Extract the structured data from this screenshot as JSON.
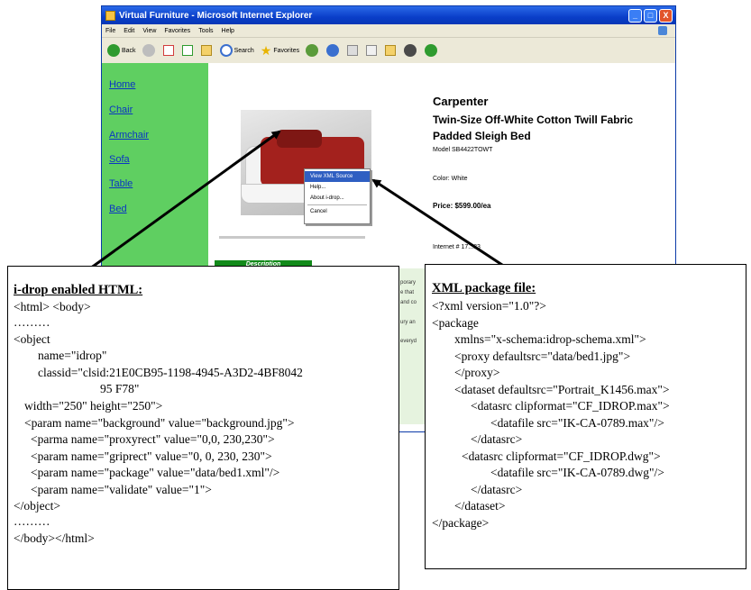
{
  "window": {
    "title": "Virtual Furniture - Microsoft Internet Explorer",
    "controls": [
      "_",
      "□",
      "X"
    ]
  },
  "menu": [
    "File",
    "Edit",
    "View",
    "Favorites",
    "Tools",
    "Help"
  ],
  "toolbar": {
    "back": "Back",
    "search": "Search",
    "favorites": "Favorites"
  },
  "sidebar": {
    "items": [
      "Home",
      "Chair",
      "Armchair",
      "Sofa",
      "Table",
      "Bed"
    ]
  },
  "product": {
    "brand": "Carpenter",
    "name": "Twin-Size Off-White Cotton Twill Fabric Padded Sleigh Bed",
    "model": "Model SB4422TOWT",
    "color": "Color: White",
    "price": "Price: $599.00/ea",
    "internet": "Internet # 17...83",
    "description_tab": "Description"
  },
  "context_menu": {
    "items": [
      "View XML Source",
      "Help...",
      "About i-drop...",
      "Cancel"
    ]
  },
  "snippets": [
    "porary",
    "e that",
    "and co",
    "ury an",
    "everyd"
  ],
  "html_box": {
    "title": "i-drop enabled HTML:",
    "lines": [
      "<html> <body>",
      "………",
      "<object",
      "name=\"idrop\"",
      "classid=\"clsid:21E0CB95-1198-4945-A3D2-4BF8042",
      "95 F78\"",
      "width=\"250\" height=\"250\">",
      "<param name=\"background\" value=\"background.jpg\">",
      "<parma name=\"proxyrect\" value=\"0,0, 230,230\">",
      "<param name=\"griprect\" value=\"0, 0, 230, 230\">",
      "<param name=\"package\" value=\"data/bed1.xml\"/>",
      "<param name=\"validate\" value=\"1\">",
      "</object>",
      "………",
      "</body></html>"
    ]
  },
  "xml_box": {
    "title": "XML package file:",
    "lines": [
      "<?xml version=\"1.0\"?>",
      "<package",
      "xmlns=\"x-schema:idrop-schema.xml\">",
      "<proxy defaultsrc=\"data/bed1.jpg\">",
      "</proxy>",
      "<dataset defaultsrc=\"Portrait_K1456.max\">",
      "<datasrc clipformat=\"CF_IDROP.max\">",
      "<datafile src=\"IK-CA-0789.max\"/>",
      "</datasrc>",
      "<datasrc clipformat=\"CF_IDROP.dwg\">",
      "<datafile src=\"IK-CA-0789.dwg\"/>",
      "</datasrc>",
      "</dataset>",
      "</package>"
    ]
  },
  "colors": {
    "sidebar_green": "#5fcf61",
    "link_blue": "#0a34c4",
    "titlebar_blue": "#0a3ec9",
    "bed_red": "#a3211d",
    "menu_highlight": "#2f5fc2"
  }
}
